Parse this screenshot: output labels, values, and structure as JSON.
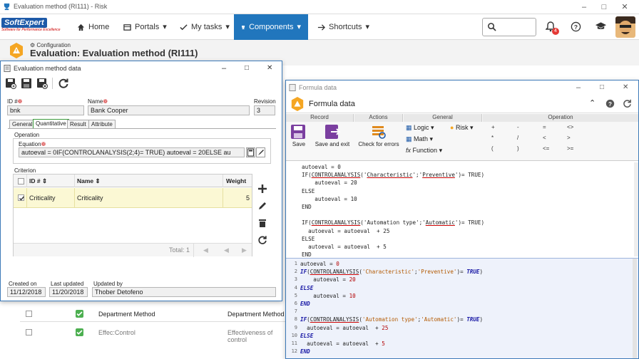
{
  "window": {
    "title": "Evaluation method (RI111) - Risk"
  },
  "nav": {
    "logo_main": "SoftExpert",
    "logo_sub": "Software for Performance Excellence",
    "home": "Home",
    "portals": "Portals",
    "my_tasks": "My tasks",
    "components": "Components",
    "shortcuts": "Shortcuts",
    "notifications_count": "4"
  },
  "page": {
    "breadcrumb": "Configuration",
    "title": "Evaluation: Evaluation method (RI111)"
  },
  "background_list": {
    "rows": [
      {
        "name": "Department Method",
        "desc": "Department Method"
      },
      {
        "name": "Effec:Control",
        "desc": "Effectiveness of control"
      }
    ]
  },
  "eval_window": {
    "title": "Evaluation method data",
    "id_label": "ID #",
    "id_value": "bnk",
    "name_label": "Name",
    "name_value": "Bank Cooper",
    "revision_label": "Revision",
    "revision_value": "3",
    "tabs": [
      "General",
      "Quantitative",
      "Result",
      "Attribute"
    ],
    "operation_label": "Operation",
    "equation_label": "Equation",
    "equation_value": "autoeval = 0IF(CONTROLANALYSIS(2;4)= TRUE)    autoeval = 20ELSE    au",
    "criterion_label": "Criterion",
    "columns": {
      "id": "ID #",
      "name": "Name",
      "weight": "Weight"
    },
    "rows": [
      {
        "id": "Criticality",
        "name": "Criticality",
        "weight": "5"
      }
    ],
    "total": "Total: 1",
    "created_label": "Created on",
    "created_value": "11/12/2018",
    "updated_label": "Last updated",
    "updated_value": "11/20/2018",
    "updated_by_label": "Updated by",
    "updated_by_value": "Thober Detofeno"
  },
  "formula_window": {
    "title": "Formula data",
    "header": "Formula data",
    "groups": {
      "record": "Record",
      "actions": "Actions",
      "general": "General",
      "operation": "Operation"
    },
    "save": "Save",
    "save_exit": "Save and exit",
    "check_errors": "Check for errors",
    "logic": "Logic",
    "math": "Math",
    "function": "Function",
    "risk": "Risk",
    "operators": [
      "+",
      "-",
      "=",
      "<>",
      "*",
      "/",
      "<",
      ">",
      "(",
      ")",
      "<=",
      ">="
    ],
    "line_numbers": [
      "1",
      "2",
      "3",
      "4",
      "5",
      "6",
      "7",
      "8",
      "9",
      "10",
      "11",
      "12"
    ]
  }
}
